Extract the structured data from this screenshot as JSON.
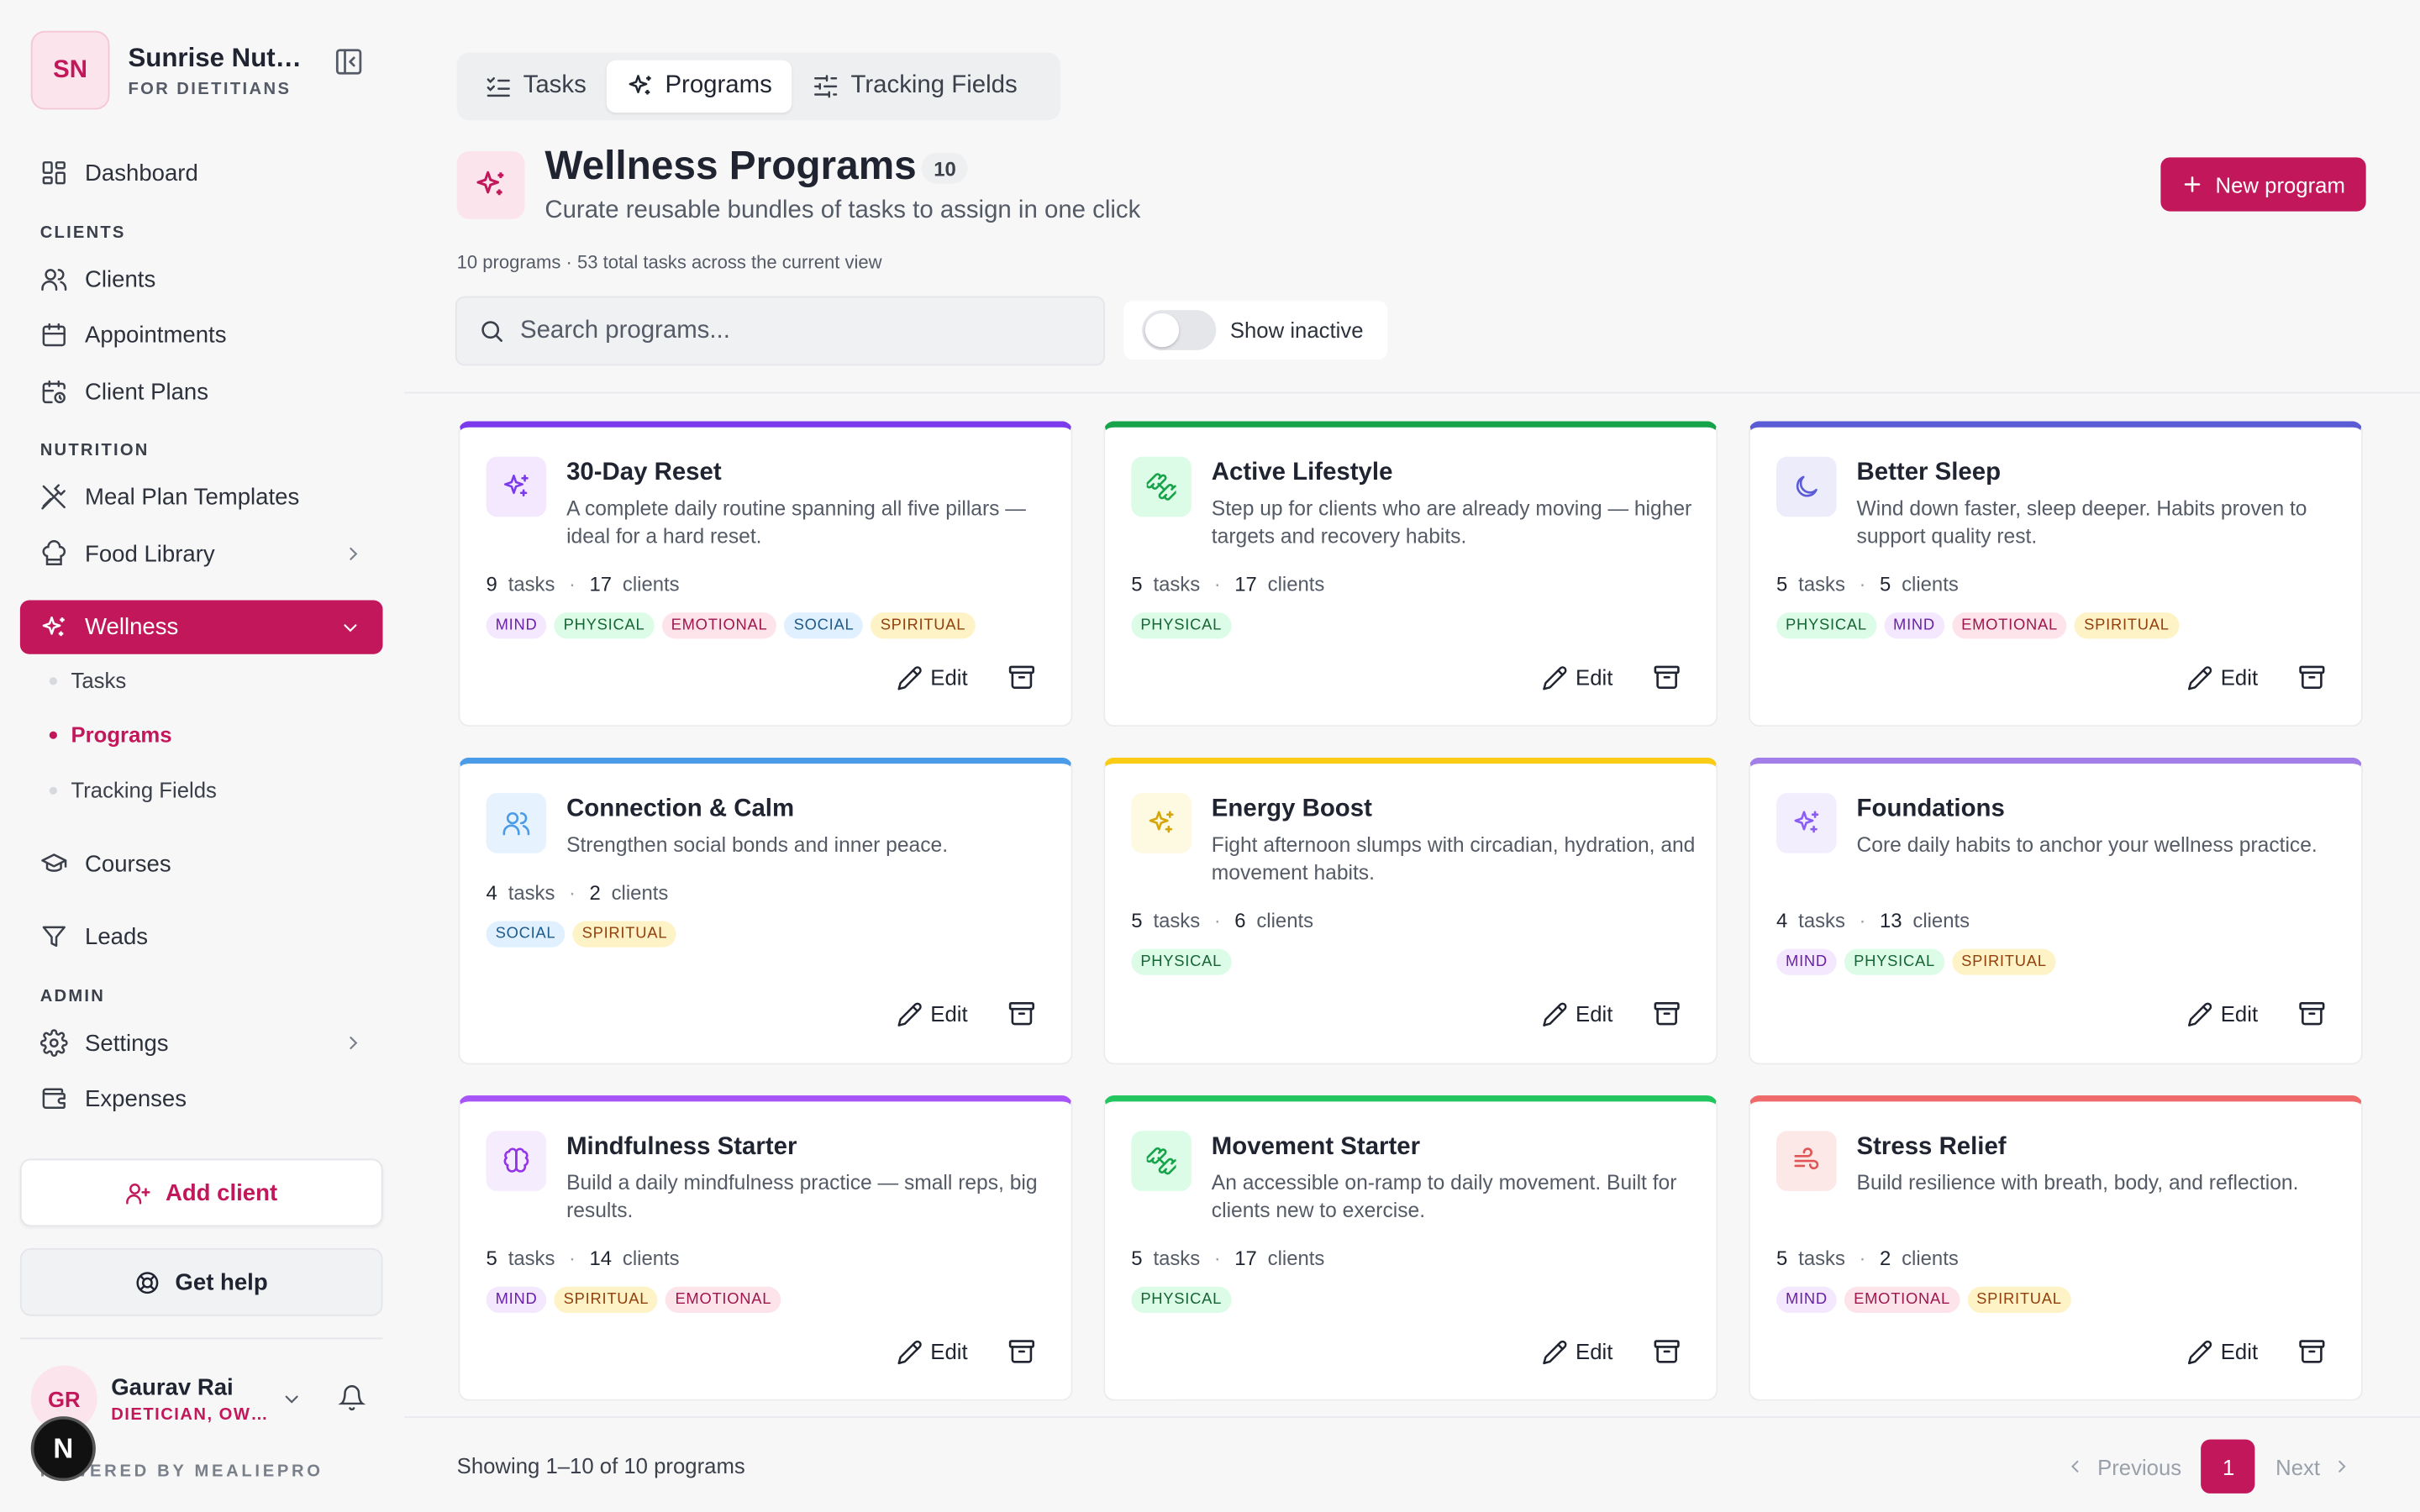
{
  "org": {
    "initials": "SN",
    "name": "Sunrise Nutrition",
    "subtitle": "FOR DIETITIANS"
  },
  "nav": {
    "dashboard": "Dashboard",
    "section_clients": "CLIENTS",
    "clients": "Clients",
    "appointments": "Appointments",
    "client_plans": "Client Plans",
    "section_nutrition": "NUTRITION",
    "meal_plan_templates": "Meal Plan Templates",
    "food_library": "Food Library",
    "wellness": "Wellness",
    "wellness_sub": [
      "Tasks",
      "Programs",
      "Tracking Fields"
    ],
    "courses": "Courses",
    "leads": "Leads",
    "section_admin": "ADMIN",
    "settings": "Settings",
    "expenses": "Expenses"
  },
  "sidebar_actions": {
    "add_client": "Add client",
    "get_help": "Get help"
  },
  "user": {
    "initials": "GR",
    "name": "Gaurav Rai",
    "role": "DIETICIAN, OWNER"
  },
  "powered_by": "POWERED BY MEALIEPRO",
  "dev_badge": "N",
  "tabs": [
    "Tasks",
    "Programs",
    "Tracking Fields"
  ],
  "header": {
    "title": "Wellness Programs",
    "count": "10",
    "subtitle": "Curate reusable bundles of tasks to assign in one click",
    "meta": "10 programs · 53 total tasks across the current view",
    "new_button": "New program"
  },
  "search": {
    "placeholder": "Search programs..."
  },
  "toggle": {
    "label": "Show inactive",
    "on": false
  },
  "card_labels": {
    "tasks": "tasks",
    "clients": "clients",
    "edit": "Edit"
  },
  "colors": {
    "accent": "#c2185b"
  },
  "programs": [
    {
      "title": "30-Day Reset",
      "desc": "A complete daily routine spanning all five pillars — ideal for a hard reset.",
      "tasks": "9",
      "clients": "17",
      "tags": [
        "MIND",
        "PHYSICAL",
        "EMOTIONAL",
        "SOCIAL",
        "SPIRITUAL"
      ],
      "color": "#7c3aed",
      "icon_bg": "#f3e8fd",
      "icon": "sparkles-icon"
    },
    {
      "title": "Active Lifestyle",
      "desc": "Step up for clients who are already moving — higher targets and recovery habits.",
      "tasks": "5",
      "clients": "17",
      "tags": [
        "PHYSICAL"
      ],
      "color": "#16a34a",
      "icon_bg": "#dcfce7",
      "icon": "dumbbell-icon"
    },
    {
      "title": "Better Sleep",
      "desc": "Wind down faster, sleep deeper. Habits proven to support quality rest.",
      "tasks": "5",
      "clients": "5",
      "tags": [
        "PHYSICAL",
        "MIND",
        "EMOTIONAL",
        "SPIRITUAL"
      ],
      "color": "#5b5bd6",
      "icon_bg": "#ececfb",
      "icon": "moon-icon"
    },
    {
      "title": "Connection & Calm",
      "desc": "Strengthen social bonds and inner peace.",
      "tasks": "4",
      "clients": "2",
      "tags": [
        "SOCIAL",
        "SPIRITUAL"
      ],
      "color": "#4a9be8",
      "icon_bg": "#e6f2fd",
      "icon": "users-icon"
    },
    {
      "title": "Energy Boost",
      "desc": "Fight afternoon slumps with circadian, hydration, and movement habits.",
      "tasks": "5",
      "clients": "6",
      "tags": [
        "PHYSICAL"
      ],
      "color": "#facc15",
      "icon_bg": "#fef9e1",
      "icon": "sparkles-icon"
    },
    {
      "title": "Foundations",
      "desc": "Core daily habits to anchor your wellness practice.",
      "tasks": "4",
      "clients": "13",
      "tags": [
        "MIND",
        "PHYSICAL",
        "SPIRITUAL"
      ],
      "color": "#a27ee8",
      "icon_bg": "#f3eefd",
      "icon": "sparkles-icon"
    },
    {
      "title": "Mindfulness Starter",
      "desc": "Build a daily mindfulness practice — small reps, big results.",
      "tasks": "5",
      "clients": "14",
      "tags": [
        "MIND",
        "SPIRITUAL",
        "EMOTIONAL"
      ],
      "color": "#a855f7",
      "icon_bg": "#f5ecfe",
      "icon": "brain-icon"
    },
    {
      "title": "Movement Starter",
      "desc": "An accessible on-ramp to daily movement. Built for clients new to exercise.",
      "tasks": "5",
      "clients": "17",
      "tags": [
        "PHYSICAL"
      ],
      "color": "#22c55e",
      "icon_bg": "#dcfce7",
      "icon": "dumbbell-icon"
    },
    {
      "title": "Stress Relief",
      "desc": "Build resilience with breath, body, and reflection.",
      "tasks": "5",
      "clients": "2",
      "tags": [
        "MIND",
        "EMOTIONAL",
        "SPIRITUAL"
      ],
      "color": "#ef6a6a",
      "icon_bg": "#fde8e8",
      "icon": "wind-icon"
    }
  ],
  "footer": {
    "showing": "Showing 1–10 of 10 programs",
    "previous": "Previous",
    "page": "1",
    "next": "Next"
  }
}
